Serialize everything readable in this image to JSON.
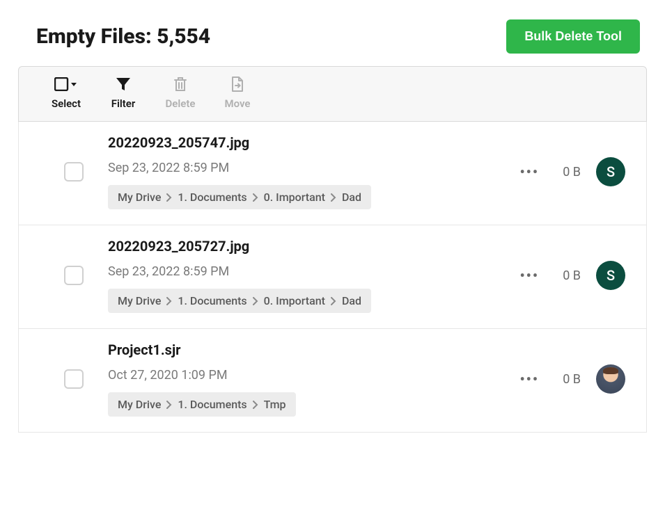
{
  "header": {
    "title": "Empty Files: 5,554",
    "bulk_button": "Bulk Delete Tool"
  },
  "toolbar": {
    "select": "Select",
    "filter": "Filter",
    "delete": "Delete",
    "move": "Move"
  },
  "files": [
    {
      "name": "20220923_205747.jpg",
      "date": "Sep 23, 2022 8:59 PM",
      "size": "0 B",
      "avatar_type": "initial",
      "avatar_initial": "S",
      "path": [
        "My Drive",
        "1. Documents",
        "0. Important",
        "Dad"
      ]
    },
    {
      "name": "20220923_205727.jpg",
      "date": "Sep 23, 2022 8:59 PM",
      "size": "0 B",
      "avatar_type": "initial",
      "avatar_initial": "S",
      "path": [
        "My Drive",
        "1. Documents",
        "0. Important",
        "Dad"
      ]
    },
    {
      "name": "Project1.sjr",
      "date": "Oct 27, 2020 1:09 PM",
      "size": "0 B",
      "avatar_type": "photo",
      "avatar_initial": "",
      "path": [
        "My Drive",
        "1. Documents",
        "Tmp"
      ]
    }
  ]
}
